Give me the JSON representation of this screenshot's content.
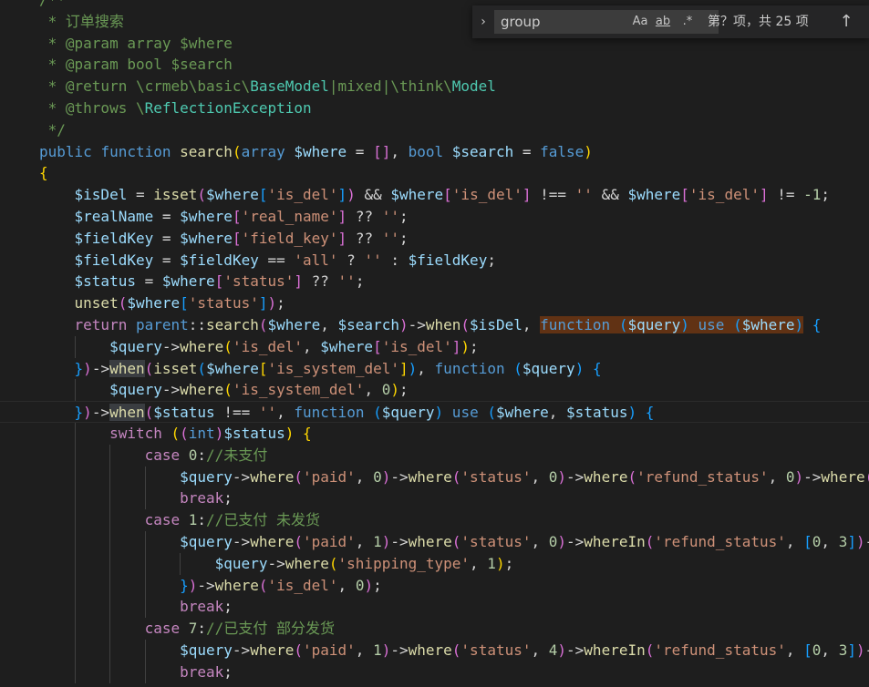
{
  "find_widget": {
    "toggle_icon": "chevron-right-icon",
    "query": "group",
    "match_case_label": "Aa",
    "whole_word_label": "ab",
    "regex_label": ".*",
    "match_count": "第？项，共 25 项",
    "prev_icon": "arrow-up-icon"
  },
  "code_lines": [
    [
      [
        "cm",
        "/**"
      ]
    ],
    [
      [
        "cm",
        " * 订单搜索"
      ]
    ],
    [
      [
        "cm",
        " * @param array $where"
      ]
    ],
    [
      [
        "cm",
        " * @param bool $search"
      ]
    ],
    [
      [
        "cm",
        " * @return \\crmeb\\basic\\"
      ],
      [
        "ty",
        "BaseModel"
      ],
      [
        "cm",
        "|mixed|\\think\\"
      ],
      [
        "ty",
        "Model"
      ]
    ],
    [
      [
        "cm",
        " * @throws \\"
      ],
      [
        "ty",
        "ReflectionException"
      ]
    ],
    [
      [
        "cm",
        " */"
      ]
    ],
    [
      [
        "kw",
        "public "
      ],
      [
        "kw",
        "function "
      ],
      [
        "fn",
        "search"
      ],
      [
        "b1",
        "("
      ],
      [
        "kw",
        "array "
      ],
      [
        "var",
        "$where"
      ],
      [
        "op",
        " = "
      ],
      [
        "b2",
        "[]"
      ],
      [
        "op",
        ", "
      ],
      [
        "kw",
        "bool "
      ],
      [
        "var",
        "$search"
      ],
      [
        "op",
        " = "
      ],
      [
        "kw",
        "false"
      ],
      [
        "b1",
        ")"
      ]
    ],
    [
      [
        "b1",
        "{"
      ]
    ],
    [
      [
        "op",
        "    "
      ],
      [
        "var",
        "$isDel"
      ],
      [
        "op",
        " = "
      ],
      [
        "fn",
        "isset"
      ],
      [
        "b2",
        "("
      ],
      [
        "var",
        "$where"
      ],
      [
        "b3",
        "["
      ],
      [
        "str",
        "'is_del'"
      ],
      [
        "b3",
        "]"
      ],
      [
        "b2",
        ")"
      ],
      [
        "op",
        " && "
      ],
      [
        "var",
        "$where"
      ],
      [
        "b2",
        "["
      ],
      [
        "str",
        "'is_del'"
      ],
      [
        "b2",
        "]"
      ],
      [
        "op",
        " !== "
      ],
      [
        "str",
        "''"
      ],
      [
        "op",
        " && "
      ],
      [
        "var",
        "$where"
      ],
      [
        "b2",
        "["
      ],
      [
        "str",
        "'is_del'"
      ],
      [
        "b2",
        "]"
      ],
      [
        "op",
        " != "
      ],
      [
        "num",
        "-1"
      ],
      [
        "op",
        ";"
      ]
    ],
    [
      [
        "op",
        "    "
      ],
      [
        "var",
        "$realName"
      ],
      [
        "op",
        " = "
      ],
      [
        "var",
        "$where"
      ],
      [
        "b2",
        "["
      ],
      [
        "str",
        "'real_name'"
      ],
      [
        "b2",
        "]"
      ],
      [
        "op",
        " ?? "
      ],
      [
        "str",
        "''"
      ],
      [
        "op",
        ";"
      ]
    ],
    [
      [
        "op",
        "    "
      ],
      [
        "var",
        "$fieldKey"
      ],
      [
        "op",
        " = "
      ],
      [
        "var",
        "$where"
      ],
      [
        "b2",
        "["
      ],
      [
        "str",
        "'field_key'"
      ],
      [
        "b2",
        "]"
      ],
      [
        "op",
        " ?? "
      ],
      [
        "str",
        "''"
      ],
      [
        "op",
        ";"
      ]
    ],
    [
      [
        "op",
        "    "
      ],
      [
        "var",
        "$fieldKey"
      ],
      [
        "op",
        " = "
      ],
      [
        "var",
        "$fieldKey"
      ],
      [
        "op",
        " == "
      ],
      [
        "str",
        "'all'"
      ],
      [
        "op",
        " ? "
      ],
      [
        "str",
        "''"
      ],
      [
        "op",
        " : "
      ],
      [
        "var",
        "$fieldKey"
      ],
      [
        "op",
        ";"
      ]
    ],
    [
      [
        "op",
        "    "
      ],
      [
        "var",
        "$status"
      ],
      [
        "op",
        " = "
      ],
      [
        "var",
        "$where"
      ],
      [
        "b2",
        "["
      ],
      [
        "str",
        "'status'"
      ],
      [
        "b2",
        "]"
      ],
      [
        "op",
        " ?? "
      ],
      [
        "str",
        "''"
      ],
      [
        "op",
        ";"
      ]
    ],
    [
      [
        "op",
        "    "
      ],
      [
        "fn",
        "unset"
      ],
      [
        "b2",
        "("
      ],
      [
        "var",
        "$where"
      ],
      [
        "b3",
        "["
      ],
      [
        "str",
        "'status'"
      ],
      [
        "b3",
        "]"
      ],
      [
        "b2",
        ")"
      ],
      [
        "op",
        ";"
      ]
    ],
    [
      [
        "op",
        "    "
      ],
      [
        "ctl",
        "return "
      ],
      [
        "kw",
        "parent"
      ],
      [
        "op",
        "::"
      ],
      [
        "fn",
        "search"
      ],
      [
        "b2",
        "("
      ],
      [
        "var",
        "$where"
      ],
      [
        "op",
        ", "
      ],
      [
        "var",
        "$search"
      ],
      [
        "b2",
        ")"
      ],
      [
        "op",
        "->"
      ],
      [
        "fn",
        "when"
      ],
      [
        "b2",
        "("
      ],
      [
        "var",
        "$isDel"
      ],
      [
        "op",
        ", "
      ],
      [
        "kwhl",
        "function "
      ],
      [
        "b3hl",
        "("
      ],
      [
        "varhl",
        "$query"
      ],
      [
        "b3hl",
        ")"
      ],
      [
        "kwhl",
        " use "
      ],
      [
        "b3hl",
        "("
      ],
      [
        "varhl",
        "$where"
      ],
      [
        "b3hl",
        ")"
      ],
      [
        "op",
        " "
      ],
      [
        "b3",
        "{"
      ]
    ],
    [
      [
        "op",
        "        "
      ],
      [
        "var",
        "$query"
      ],
      [
        "op",
        "->"
      ],
      [
        "fn",
        "where"
      ],
      [
        "b1",
        "("
      ],
      [
        "str",
        "'is_del'"
      ],
      [
        "op",
        ", "
      ],
      [
        "var",
        "$where"
      ],
      [
        "b2",
        "["
      ],
      [
        "str",
        "'is_del'"
      ],
      [
        "b2",
        "]"
      ],
      [
        "b1",
        ")"
      ],
      [
        "op",
        ";"
      ]
    ],
    [
      [
        "op",
        "    "
      ],
      [
        "b3",
        "}"
      ],
      [
        "b2",
        ")"
      ],
      [
        "op",
        "->"
      ],
      [
        "fnhl",
        "when"
      ],
      [
        "b2",
        "("
      ],
      [
        "fn",
        "isset"
      ],
      [
        "b3",
        "("
      ],
      [
        "var",
        "$where"
      ],
      [
        "b1",
        "["
      ],
      [
        "str",
        "'is_system_del'"
      ],
      [
        "b1",
        "]"
      ],
      [
        "b3",
        ")"
      ],
      [
        "op",
        ", "
      ],
      [
        "kw",
        "function "
      ],
      [
        "b3",
        "("
      ],
      [
        "var",
        "$query"
      ],
      [
        "b3",
        ")"
      ],
      [
        "op",
        " "
      ],
      [
        "b3",
        "{"
      ]
    ],
    [
      [
        "op",
        "        "
      ],
      [
        "var",
        "$query"
      ],
      [
        "op",
        "->"
      ],
      [
        "fn",
        "where"
      ],
      [
        "b1",
        "("
      ],
      [
        "str",
        "'is_system_del'"
      ],
      [
        "op",
        ", "
      ],
      [
        "num",
        "0"
      ],
      [
        "b1",
        ")"
      ],
      [
        "op",
        ";"
      ]
    ],
    [
      [
        "op",
        "    "
      ],
      [
        "b3",
        "}"
      ],
      [
        "b2",
        ")"
      ],
      [
        "op",
        "->"
      ],
      [
        "fnhl",
        "when"
      ],
      [
        "b2",
        "("
      ],
      [
        "var",
        "$status"
      ],
      [
        "op",
        " !== "
      ],
      [
        "str",
        "''"
      ],
      [
        "op",
        ", "
      ],
      [
        "kw",
        "function "
      ],
      [
        "b3",
        "("
      ],
      [
        "var",
        "$query"
      ],
      [
        "b3",
        ")"
      ],
      [
        "kw",
        " use "
      ],
      [
        "b3",
        "("
      ],
      [
        "var",
        "$where"
      ],
      [
        "op",
        ", "
      ],
      [
        "var",
        "$status"
      ],
      [
        "b3",
        ")"
      ],
      [
        "op",
        " "
      ],
      [
        "b3",
        "{"
      ]
    ],
    [
      [
        "op",
        "        "
      ],
      [
        "ctl",
        "switch "
      ],
      [
        "b1",
        "("
      ],
      [
        "b2",
        "("
      ],
      [
        "kw",
        "int"
      ],
      [
        "b2",
        ")"
      ],
      [
        "var",
        "$status"
      ],
      [
        "b1",
        ")"
      ],
      [
        "op",
        " "
      ],
      [
        "b1",
        "{"
      ]
    ],
    [
      [
        "op",
        "            "
      ],
      [
        "ctl",
        "case "
      ],
      [
        "num",
        "0"
      ],
      [
        "op",
        ":"
      ],
      [
        "cm",
        "//未支付"
      ]
    ],
    [
      [
        "op",
        "                "
      ],
      [
        "var",
        "$query"
      ],
      [
        "op",
        "->"
      ],
      [
        "fn",
        "where"
      ],
      [
        "b2",
        "("
      ],
      [
        "str",
        "'paid'"
      ],
      [
        "op",
        ", "
      ],
      [
        "num",
        "0"
      ],
      [
        "b2",
        ")"
      ],
      [
        "op",
        "->"
      ],
      [
        "fn",
        "where"
      ],
      [
        "b2",
        "("
      ],
      [
        "str",
        "'status'"
      ],
      [
        "op",
        ", "
      ],
      [
        "num",
        "0"
      ],
      [
        "b2",
        ")"
      ],
      [
        "op",
        "->"
      ],
      [
        "fn",
        "where"
      ],
      [
        "b2",
        "("
      ],
      [
        "str",
        "'refund_status'"
      ],
      [
        "op",
        ", "
      ],
      [
        "num",
        "0"
      ],
      [
        "b2",
        ")"
      ],
      [
        "op",
        "->"
      ],
      [
        "fn",
        "where"
      ],
      [
        "b2",
        "("
      ]
    ],
    [
      [
        "op",
        "                "
      ],
      [
        "ctl",
        "break"
      ],
      [
        "op",
        ";"
      ]
    ],
    [
      [
        "op",
        "            "
      ],
      [
        "ctl",
        "case "
      ],
      [
        "num",
        "1"
      ],
      [
        "op",
        ":"
      ],
      [
        "cm",
        "//已支付 未发货"
      ]
    ],
    [
      [
        "op",
        "                "
      ],
      [
        "var",
        "$query"
      ],
      [
        "op",
        "->"
      ],
      [
        "fn",
        "where"
      ],
      [
        "b2",
        "("
      ],
      [
        "str",
        "'paid'"
      ],
      [
        "op",
        ", "
      ],
      [
        "num",
        "1"
      ],
      [
        "b2",
        ")"
      ],
      [
        "op",
        "->"
      ],
      [
        "fn",
        "where"
      ],
      [
        "b2",
        "("
      ],
      [
        "str",
        "'status'"
      ],
      [
        "op",
        ", "
      ],
      [
        "num",
        "0"
      ],
      [
        "b2",
        ")"
      ],
      [
        "op",
        "->"
      ],
      [
        "fn",
        "whereIn"
      ],
      [
        "b2",
        "("
      ],
      [
        "str",
        "'refund_status'"
      ],
      [
        "op",
        ", "
      ],
      [
        "b3",
        "["
      ],
      [
        "num",
        "0"
      ],
      [
        "op",
        ", "
      ],
      [
        "num",
        "3"
      ],
      [
        "b3",
        "]"
      ],
      [
        "b2",
        ")"
      ],
      [
        "op",
        "-"
      ]
    ],
    [
      [
        "op",
        "                    "
      ],
      [
        "var",
        "$query"
      ],
      [
        "op",
        "->"
      ],
      [
        "fn",
        "where"
      ],
      [
        "b1",
        "("
      ],
      [
        "str",
        "'shipping_type'"
      ],
      [
        "op",
        ", "
      ],
      [
        "num",
        "1"
      ],
      [
        "b1",
        ")"
      ],
      [
        "op",
        ";"
      ]
    ],
    [
      [
        "op",
        "                "
      ],
      [
        "b3",
        "}"
      ],
      [
        "b2",
        ")"
      ],
      [
        "op",
        "->"
      ],
      [
        "fn",
        "where"
      ],
      [
        "b2",
        "("
      ],
      [
        "str",
        "'is_del'"
      ],
      [
        "op",
        ", "
      ],
      [
        "num",
        "0"
      ],
      [
        "b2",
        ")"
      ],
      [
        "op",
        ";"
      ]
    ],
    [
      [
        "op",
        "                "
      ],
      [
        "ctl",
        "break"
      ],
      [
        "op",
        ";"
      ]
    ],
    [
      [
        "op",
        "            "
      ],
      [
        "ctl",
        "case "
      ],
      [
        "num",
        "7"
      ],
      [
        "op",
        ":"
      ],
      [
        "cm",
        "//已支付 部分发货"
      ]
    ],
    [
      [
        "op",
        "                "
      ],
      [
        "var",
        "$query"
      ],
      [
        "op",
        "->"
      ],
      [
        "fn",
        "where"
      ],
      [
        "b2",
        "("
      ],
      [
        "str",
        "'paid'"
      ],
      [
        "op",
        ", "
      ],
      [
        "num",
        "1"
      ],
      [
        "b2",
        ")"
      ],
      [
        "op",
        "->"
      ],
      [
        "fn",
        "where"
      ],
      [
        "b2",
        "("
      ],
      [
        "str",
        "'status'"
      ],
      [
        "op",
        ", "
      ],
      [
        "num",
        "4"
      ],
      [
        "b2",
        ")"
      ],
      [
        "op",
        "->"
      ],
      [
        "fn",
        "whereIn"
      ],
      [
        "b2",
        "("
      ],
      [
        "str",
        "'refund_status'"
      ],
      [
        "op",
        ", "
      ],
      [
        "b3",
        "["
      ],
      [
        "num",
        "0"
      ],
      [
        "op",
        ", "
      ],
      [
        "num",
        "3"
      ],
      [
        "b3",
        "]"
      ],
      [
        "b2",
        ")"
      ],
      [
        "op",
        "-"
      ]
    ],
    [
      [
        "op",
        "                "
      ],
      [
        "ctl",
        "break"
      ],
      [
        "op",
        ";"
      ]
    ]
  ],
  "colors": {
    "background": "#1e1e1e",
    "find_highlight": "#613214",
    "word_highlight": "#3a3d41"
  }
}
